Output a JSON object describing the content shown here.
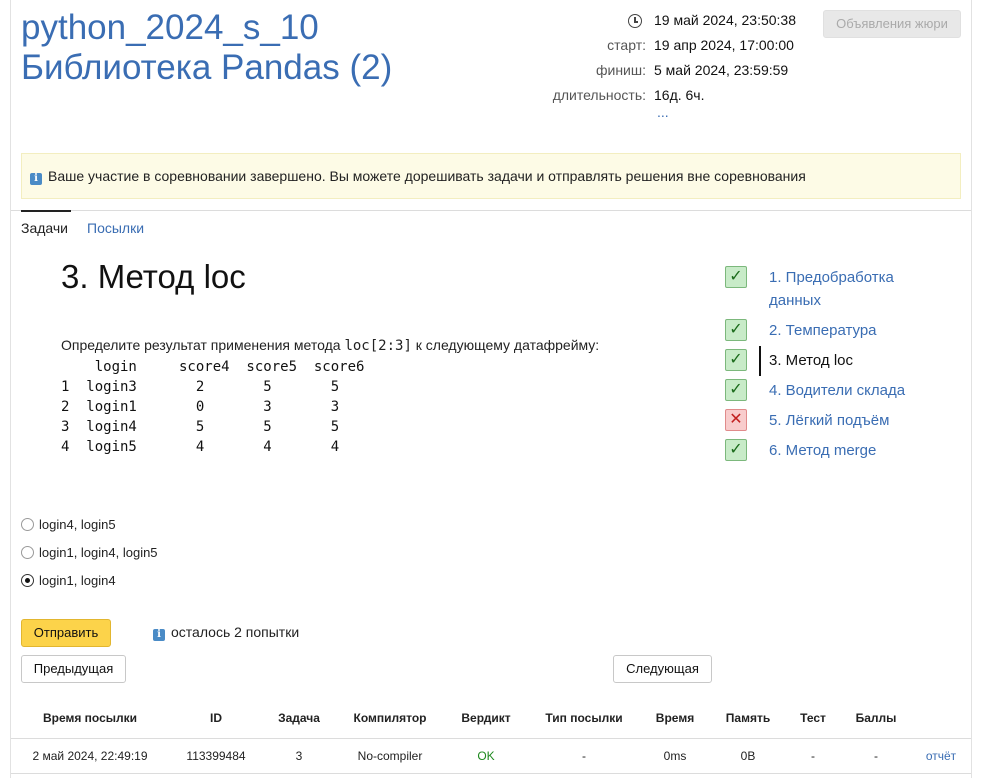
{
  "header": {
    "title_line1": "python_2024_s_10",
    "title_line2": "Библиотека Pandas (2)",
    "current_time": "19 май 2024, 23:50:38",
    "start_label": "старт:",
    "start_value": "19 апр 2024, 17:00:00",
    "finish_label": "финиш:",
    "finish_value": "5 май 2024, 23:59:59",
    "duration_label": "длительность:",
    "duration_value": "16д. 6ч.",
    "more": "...",
    "jury_button": "Объявления жюри"
  },
  "notice": {
    "icon": "i",
    "text": "Ваше участие в соревновании завершено. Вы можете дорешивать задачи и отправлять решения вне соревнования"
  },
  "tabs": [
    {
      "label": "Задачи"
    },
    {
      "label": "Посылки"
    }
  ],
  "problem": {
    "title": "3. Метод loc",
    "statement_before": "Определите результат применения метода ",
    "statement_code": "loc[2:3]",
    "statement_after": " к следующему датафрейму:",
    "dataframe": "    login     score4  score5  score6\n1  login3       2       5       5\n2  login1       0       3       3\n3  login4       5       5       5\n4  login5       4       4       4"
  },
  "problem_list": [
    {
      "name": "1. Предобработка данных",
      "status": "ok",
      "mark": "✓"
    },
    {
      "name": "2. Температура",
      "status": "ok",
      "mark": "✓"
    },
    {
      "name": "3. Метод loc",
      "status": "ok",
      "mark": "✓"
    },
    {
      "name": "4. Водители склада",
      "status": "ok",
      "mark": "✓"
    },
    {
      "name": "5. Лёгкий подъём",
      "status": "fail",
      "mark": "✕"
    },
    {
      "name": "6. Метод merge",
      "status": "ok",
      "mark": "✓"
    }
  ],
  "options": [
    {
      "label": "login4, login5",
      "selected": false
    },
    {
      "label": "login1, login4, login5",
      "selected": false
    },
    {
      "label": "login1, login4",
      "selected": true
    }
  ],
  "actions": {
    "submit": "Отправить",
    "attempts_icon": "i",
    "attempts": "осталось 2 попытки",
    "prev": "Предыдущая",
    "next": "Следующая"
  },
  "submissions": {
    "headers": [
      "Время посылки",
      "ID",
      "Задача",
      "Компилятор",
      "Вердикт",
      "Тип посылки",
      "Время",
      "Память",
      "Тест",
      "Баллы"
    ],
    "rows": [
      [
        "2 май 2024, 22:49:19",
        "113399484",
        "3",
        "No-compiler",
        "OK",
        "-",
        "0ms",
        "0B",
        "-",
        "-",
        "отчёт"
      ]
    ]
  }
}
